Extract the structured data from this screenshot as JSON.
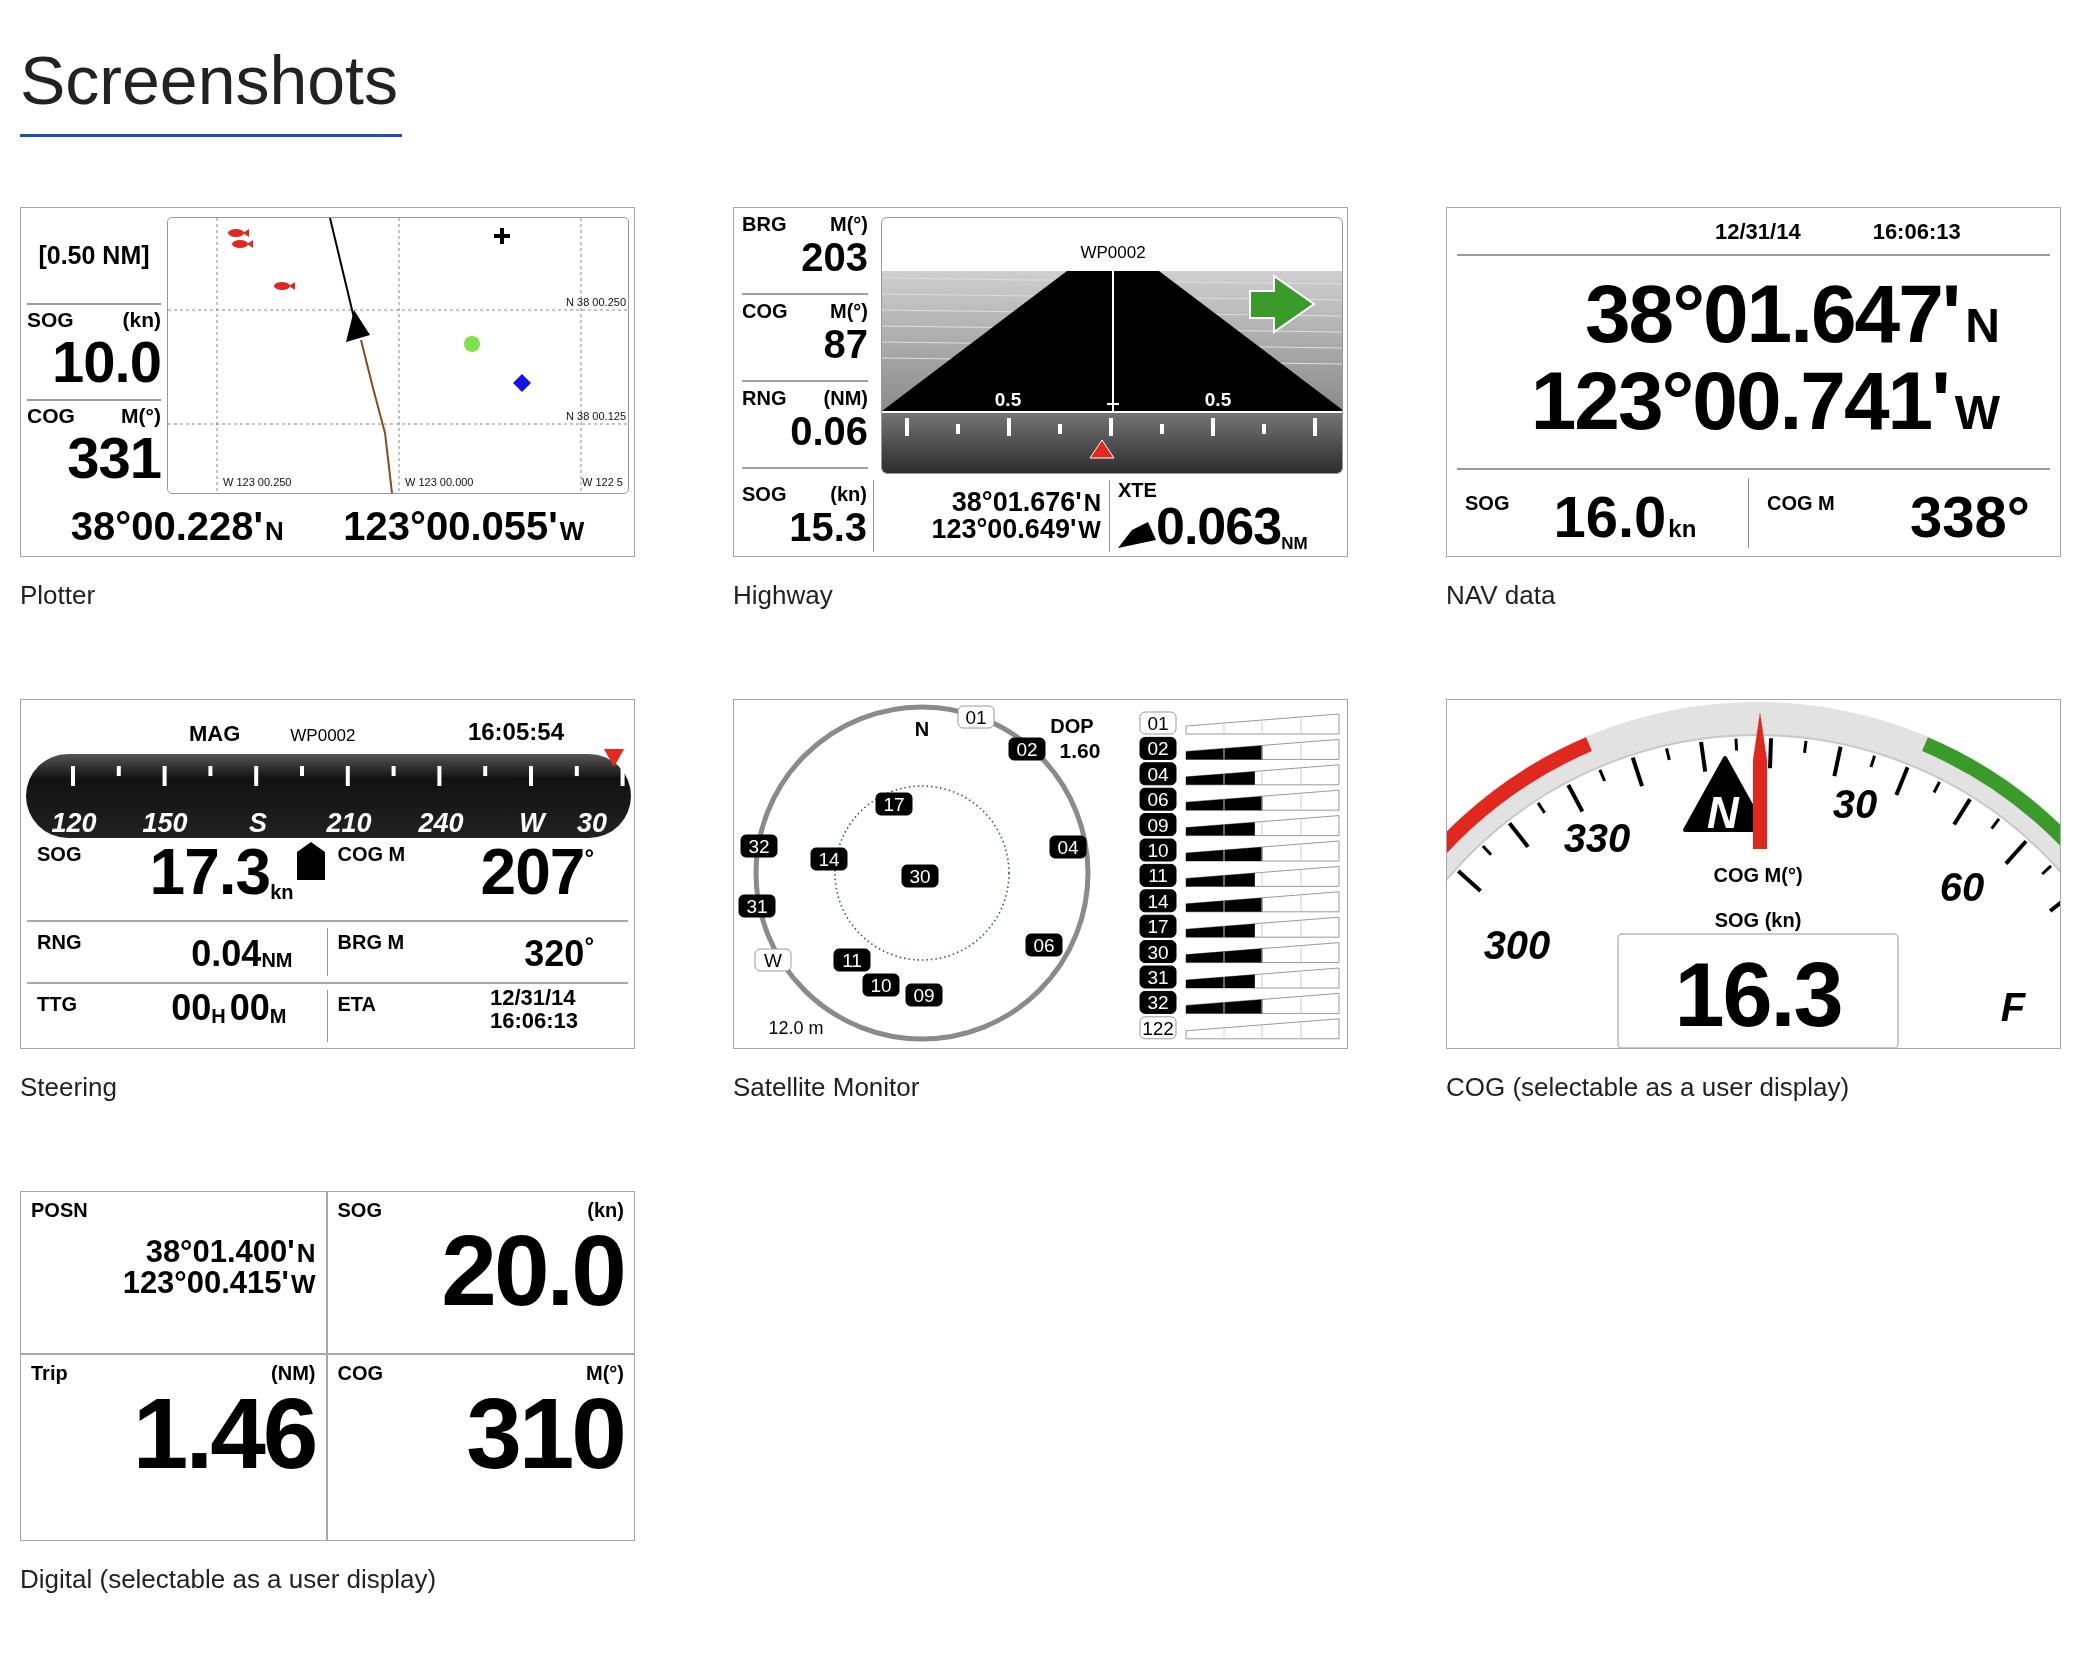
{
  "heading": "Screenshots",
  "screenshots": [
    {
      "kind": "plotter",
      "caption": "Plotter",
      "scale": "[0.50 NM]",
      "fields": [
        {
          "label": "SOG",
          "unit": "(kn)",
          "value": "10.0"
        },
        {
          "label": "COG",
          "unit": "M(°)",
          "value": "331"
        }
      ],
      "grid_labels": {
        "latitudes": [
          "N 38 00.250",
          "N 38 00.125"
        ],
        "longitudes": [
          "W 123 00.250",
          "W 123 00.000",
          "W 122 5"
        ]
      },
      "position": {
        "lat": "38°00.228'",
        "lat_hemisphere": "N",
        "lon": "123°00.055'",
        "lon_hemisphere": "W"
      }
    },
    {
      "kind": "highway",
      "caption": "Highway",
      "fields": [
        {
          "label": "BRG",
          "unit": "M(°)",
          "value": "203"
        },
        {
          "label": "COG",
          "unit": "M(°)",
          "value": "87"
        },
        {
          "label": "RNG",
          "unit": "(NM)",
          "value": "0.06"
        },
        {
          "label": "SOG",
          "unit": "(kn)",
          "value": "15.3"
        }
      ],
      "waypoint": "WP0002",
      "scale_labels": [
        "0.5",
        "0.5"
      ],
      "position": {
        "lat": "38°01.676'",
        "lat_hemisphere": "N",
        "lon": "123°00.649'",
        "lon_hemisphere": "W"
      },
      "xte": {
        "label": "XTE",
        "value": "0.063",
        "unit": "NM"
      }
    },
    {
      "kind": "nav_data",
      "caption": "NAV data",
      "date": "12/31/14",
      "time": "16:06:13",
      "position": {
        "lat": "38°01.647'",
        "lat_hemisphere": "N",
        "lon": "123°00.741'",
        "lon_hemisphere": "W"
      },
      "sog": {
        "label": "SOG",
        "value": "16.0",
        "unit": "kn"
      },
      "cog": {
        "label": "COG M",
        "value": "338°"
      }
    },
    {
      "kind": "steering",
      "caption": "Steering",
      "heading_mode": "MAG",
      "waypoint": "WP0002",
      "time": "16:05:54",
      "tape_labels": [
        "120",
        "150",
        "S",
        "210",
        "240",
        "W",
        "30"
      ],
      "fields": [
        {
          "label": "SOG",
          "value": "17.3",
          "unit": "kn"
        },
        {
          "label": "COG M",
          "value": "207",
          "unit": "°"
        },
        {
          "label": "RNG",
          "value": "0.04",
          "unit": "NM"
        },
        {
          "label": "BRG M",
          "value": "320",
          "unit": "°"
        }
      ],
      "ttg": {
        "label": "TTG",
        "hours": "00",
        "hours_unit": "H",
        "minutes": "00",
        "minutes_unit": "M"
      },
      "eta": {
        "label": "ETA",
        "date": "12/31/14",
        "time": "16:06:13"
      }
    },
    {
      "kind": "satellites",
      "caption": "Satellite Monitor",
      "north": "N",
      "dop": {
        "label": "DOP",
        "value": "1.60"
      },
      "range": "12.0 m",
      "sky": [
        {
          "id": "01",
          "used": false
        },
        {
          "id": "02",
          "used": true
        },
        {
          "id": "17",
          "used": true
        },
        {
          "id": "32",
          "used": true
        },
        {
          "id": "14",
          "used": true
        },
        {
          "id": "30",
          "used": true
        },
        {
          "id": "04",
          "used": true
        },
        {
          "id": "31",
          "used": true
        },
        {
          "id": "W",
          "used": false
        },
        {
          "id": "11",
          "used": true
        },
        {
          "id": "06",
          "used": true
        },
        {
          "id": "10",
          "used": true
        },
        {
          "id": "09",
          "used": true
        }
      ],
      "signals": [
        {
          "id": "01",
          "used": false
        },
        {
          "id": "02",
          "used": true,
          "level": 0.5
        },
        {
          "id": "04",
          "used": true,
          "level": 0.45
        },
        {
          "id": "06",
          "used": true,
          "level": 0.5
        },
        {
          "id": "09",
          "used": true,
          "level": 0.45
        },
        {
          "id": "10",
          "used": true,
          "level": 0.5
        },
        {
          "id": "11",
          "used": true,
          "level": 0.45
        },
        {
          "id": "14",
          "used": true,
          "level": 0.5
        },
        {
          "id": "17",
          "used": true,
          "level": 0.45
        },
        {
          "id": "30",
          "used": true,
          "level": 0.5
        },
        {
          "id": "31",
          "used": true,
          "level": 0.45
        },
        {
          "id": "32",
          "used": true,
          "level": 0.5
        },
        {
          "id": "122",
          "used": false
        }
      ]
    },
    {
      "kind": "cog_gauge",
      "caption": "COG (selectable as a user display)",
      "dial_labels": [
        "330",
        "30",
        "60",
        "300",
        "F"
      ],
      "north": "N",
      "cog_label": "COG M(°)",
      "sog_label": "SOG (kn)",
      "sog_value": "16.3"
    },
    {
      "kind": "digital",
      "caption": "Digital (selectable as a user display)",
      "position": {
        "label": "POSN",
        "lat": "38°01.400'",
        "lat_hemisphere": "N",
        "lon": "123°00.415'",
        "lon_hemisphere": "W"
      },
      "fields": [
        {
          "label": "SOG",
          "unit": "(kn)",
          "value": "20.0"
        },
        {
          "label": "Trip",
          "unit": "(NM)",
          "value": "1.46"
        },
        {
          "label": "COG",
          "unit": "M(°)",
          "value": "310"
        }
      ]
    }
  ]
}
